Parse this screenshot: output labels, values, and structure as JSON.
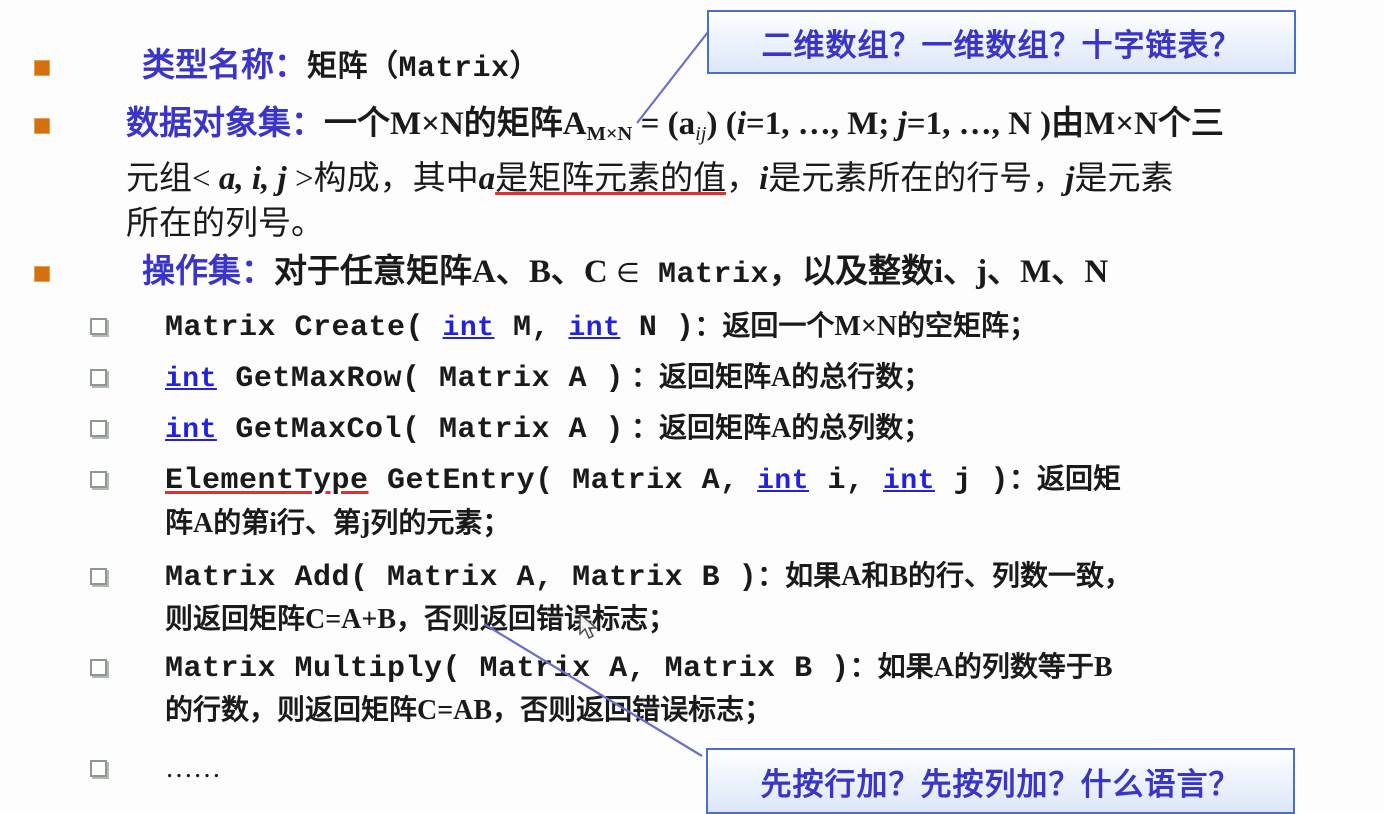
{
  "slide": {
    "bullets": [
      {
        "id": "type-name",
        "heading": "类型名称：",
        "body": "矩阵（Matrix）"
      },
      {
        "id": "data-object-set",
        "heading": "数据对象集：",
        "line1_a": "一个M×N的矩阵A",
        "line1_sub": "M×N",
        "line1_b": " = (a",
        "line1_sub2": "ij",
        "line1_c": ")  (",
        "line1_i": "i",
        "line1_d": "=1, …, M; ",
        "line1_j": "j",
        "line1_e": "=1, …, N )由M×N个三",
        "line2_a": "元组< ",
        "line2_aij": "a, i, j",
        "line2_b": " >构成，其中",
        "line2_c": "a",
        "line2_d": "是矩阵元素的值",
        "line2_e": "，",
        "line2_i": "i",
        "line2_f": "是元素所在的行号，",
        "line2_j": "j",
        "line2_g": "是元素",
        "line3": "所在的列号。"
      },
      {
        "id": "operation-set",
        "heading": "操作集：",
        "body_a": "对于任意矩阵A、B、C ",
        "body_in": "∈",
        "body_matrix": "Matrix",
        "body_b": "，以及整数i、j、M、N"
      }
    ],
    "operations": [
      {
        "id": "create",
        "sig_a": "Matrix Create( ",
        "kw1": "int",
        "sig_b": " M, ",
        "kw2": "int",
        "sig_c": " N )",
        "desc": "：返回一个M×N的空矩阵；"
      },
      {
        "id": "get-max-row",
        "kw1": "int",
        "sig_b": " GetMaxRow( Matrix A )",
        "desc": "：返回矩阵A的总行数；"
      },
      {
        "id": "get-max-col",
        "kw1": "int",
        "sig_b": " GetMaxCol( Matrix A )",
        "desc": "：返回矩阵A的总列数；"
      },
      {
        "id": "get-entry",
        "rettype": "ElementType",
        "sig_a": " GetEntry( Matrix A, ",
        "kw1": "int",
        "sig_b": " i, ",
        "kw2": "int",
        "sig_c": " j )",
        "desc": "：返回矩",
        "desc2": "阵A的第i行、第j列的元素；"
      },
      {
        "id": "add",
        "sig_a": "Matrix Add( Matrix A, Matrix B )",
        "desc": "：如果A和B的行、列数一致，",
        "desc2": "则返回矩阵C=A+B，否则返回错误标志；"
      },
      {
        "id": "multiply",
        "sig_a": "Matrix Multiply( Matrix A, Matrix B )",
        "desc": "：如果A的列数等于B",
        "desc2": "的行数，则返回矩阵C=AB，否则返回错误标志；"
      },
      {
        "id": "ellipsis",
        "sig_a": "……"
      }
    ],
    "callouts": [
      {
        "id": "storage-question",
        "text": "二维数组？一维数组？十字链表？"
      },
      {
        "id": "order-question",
        "text": "先按行加？先按列加？什么语言？"
      }
    ],
    "colors": {
      "heading_blue": "#3a34c8",
      "keyword_blue": "#2222dd",
      "underline_red": "#e03030",
      "bullet_orange": "#d4700f",
      "callout_border": "#4a6fc4",
      "leader_line": "#6a6ecb"
    }
  }
}
